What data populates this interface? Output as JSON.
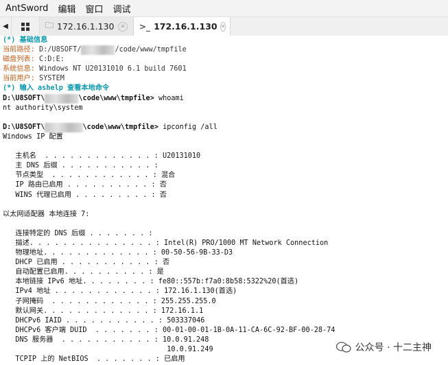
{
  "menu": [
    "AntSword",
    "编辑",
    "窗口",
    "调试"
  ],
  "tabs": [
    {
      "label": "172.16.1.130",
      "icon": "folder-icon"
    },
    {
      "label": "172.16.1.130",
      "icon": "terminal-icon"
    }
  ],
  "terminal": {
    "lines": [
      {
        "segments": [
          {
            "text": "(*) 基础信息",
            "cls": "cy"
          }
        ]
      },
      {
        "segments": [
          {
            "text": "当前路径: ",
            "cls": "ol"
          },
          {
            "text": "D:/U8SOFT/",
            "cls": "gr"
          },
          {
            "text": "xxxxxxxx",
            "cls": "blur"
          },
          {
            "text": "/code/www/tmpfile",
            "cls": "gr"
          }
        ]
      },
      {
        "segments": [
          {
            "text": "磁盘列表: ",
            "cls": "ol"
          },
          {
            "text": "C:D:E:",
            "cls": "gr"
          }
        ]
      },
      {
        "segments": [
          {
            "text": "系统信息: ",
            "cls": "ol"
          },
          {
            "text": "Windows NT U20131010 6.1 build 7601",
            "cls": "gr"
          }
        ]
      },
      {
        "segments": [
          {
            "text": "当前用户: ",
            "cls": "ol"
          },
          {
            "text": "SYSTEM",
            "cls": "gr"
          }
        ]
      },
      {
        "segments": [
          {
            "text": "(*) 输入 ashelp 查看本地命令",
            "cls": "cy"
          }
        ]
      },
      {
        "segments": [
          {
            "text": "D:\\U8SOFT\\",
            "cls": "bold"
          },
          {
            "text": "xxxxxxxx",
            "cls": "blur"
          },
          {
            "text": "\\code\\www\\tmpfile> ",
            "cls": "bold"
          },
          {
            "text": "whoami",
            "cls": ""
          }
        ]
      },
      {
        "segments": [
          {
            "text": "nt authority\\system",
            "cls": ""
          }
        ]
      },
      {
        "segments": [
          {
            "text": "",
            "cls": ""
          }
        ]
      },
      {
        "segments": [
          {
            "text": "D:\\U8SOFT\\",
            "cls": "bold"
          },
          {
            "text": "xxxxxxxxx",
            "cls": "blur"
          },
          {
            "text": "\\code\\www\\tmpfile> ",
            "cls": "bold"
          },
          {
            "text": "ipconfig /all",
            "cls": ""
          }
        ]
      },
      {
        "segments": [
          {
            "text": "Windows IP 配置",
            "cls": ""
          }
        ]
      },
      {
        "segments": [
          {
            "text": "",
            "cls": ""
          }
        ]
      },
      {
        "segments": [
          {
            "text": "   主机名  . . . . . . . . . . . . . : U20131010",
            "cls": ""
          }
        ]
      },
      {
        "segments": [
          {
            "text": "   主 DNS 后缀 . . . . . . . . . . . :",
            "cls": ""
          }
        ]
      },
      {
        "segments": [
          {
            "text": "   节点类型  . . . . . . . . . . . . : 混合",
            "cls": ""
          }
        ]
      },
      {
        "segments": [
          {
            "text": "   IP 路由已启用 . . . . . . . . . . : 否",
            "cls": ""
          }
        ]
      },
      {
        "segments": [
          {
            "text": "   WINS 代理已启用 . . . . . . . . . : 否",
            "cls": ""
          }
        ]
      },
      {
        "segments": [
          {
            "text": "",
            "cls": ""
          }
        ]
      },
      {
        "segments": [
          {
            "text": "以太网适配器 本地连接 7:",
            "cls": ""
          }
        ]
      },
      {
        "segments": [
          {
            "text": "",
            "cls": ""
          }
        ]
      },
      {
        "segments": [
          {
            "text": "   连接特定的 DNS 后缀 . . . . . . . :",
            "cls": ""
          }
        ]
      },
      {
        "segments": [
          {
            "text": "   描述. . . . . . . . . . . . . . . : Intel(R) PRO/1000 MT Network Connection",
            "cls": ""
          }
        ]
      },
      {
        "segments": [
          {
            "text": "   物理地址. . . . . . . . . . . . . : 00-50-56-9B-33-D3",
            "cls": ""
          }
        ]
      },
      {
        "segments": [
          {
            "text": "   DHCP 已启用 . . . . . . . . . . . : 否",
            "cls": ""
          }
        ]
      },
      {
        "segments": [
          {
            "text": "   自动配置已启用. . . . . . . . . . : 是",
            "cls": ""
          }
        ]
      },
      {
        "segments": [
          {
            "text": "   本地链接 IPv6 地址. . . . . . . . : fe80::557b:f7a0:8b58:5322%20(首选)",
            "cls": ""
          }
        ]
      },
      {
        "segments": [
          {
            "text": "   IPv4 地址 . . . . . . . . . . . . : 172.16.1.130(首选)",
            "cls": ""
          }
        ]
      },
      {
        "segments": [
          {
            "text": "   子网掩码  . . . . . . . . . . . . : 255.255.255.0",
            "cls": ""
          }
        ]
      },
      {
        "segments": [
          {
            "text": "   默认网关. . . . . . . . . . . . . : 172.16.1.1",
            "cls": ""
          }
        ]
      },
      {
        "segments": [
          {
            "text": "   DHCPv6 IAID . . . . . . . . . . . : 503337046",
            "cls": ""
          }
        ]
      },
      {
        "segments": [
          {
            "text": "   DHCPv6 客户端 DUID  . . . . . . . : 00-01-00-01-1B-0A-11-CA-6C-92-BF-00-28-74",
            "cls": ""
          }
        ]
      },
      {
        "segments": [
          {
            "text": "   DNS 服务器  . . . . . . . . . . . : 10.0.91.248",
            "cls": ""
          }
        ]
      },
      {
        "segments": [
          {
            "text": "                                       10.0.91.249",
            "cls": ""
          }
        ]
      },
      {
        "segments": [
          {
            "text": "   TCPIP 上的 NetBIOS  . . . . . . . : 已启用",
            "cls": ""
          }
        ]
      }
    ]
  },
  "watermark": {
    "text": "公众号 · 十二主神",
    "icon": "wechat-icon"
  }
}
